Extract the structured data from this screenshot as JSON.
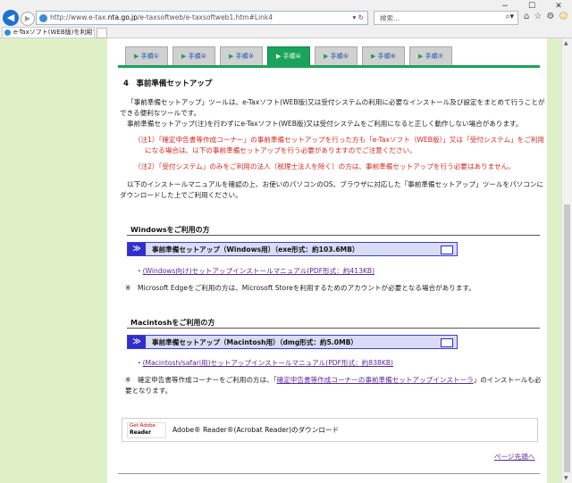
{
  "browser": {
    "url_prefix": "http://www.e-tax.",
    "url_domain": "nta.go.jp",
    "url_path": "/e-taxsoftweb/e-taxsoftweb1.htm#Link4",
    "search_placeholder": "検索...",
    "tab_title": "e-Taxソフト(WEB版)を利用す...",
    "window_controls": [
      "−",
      "☐",
      "✕"
    ]
  },
  "steps": [
    {
      "label": "手順①",
      "active": false
    },
    {
      "label": "手順②",
      "active": false
    },
    {
      "label": "手順③",
      "active": false
    },
    {
      "label": "手順④",
      "active": true
    },
    {
      "label": "手順⑤",
      "active": false
    },
    {
      "label": "手順⑥",
      "active": false
    },
    {
      "label": "手順⑦",
      "active": false
    }
  ],
  "section": {
    "title": "4　事前準備セットアップ",
    "intro_1": "「事前準備セットアップ」ツールは、e-Taxソフト(WEB版)又は受付システムの利用に必要なインストール及び設定をまとめて行うことができる便利なツールです。",
    "intro_2": "事前準備セットアップ(注)を行わずにe-Taxソフト(WEB版)又は受付システムをご利用になると正しく動作しない場合があります。",
    "note_1": "（注1）「確定申告書等作成コーナー」の事前準備セットアップを行った方も「e-Taxソフト（WEB版）」又は「受付システム」をご利用になる場合は、以下の事前準備セットアップを行う必要がありますのでご注意ください。",
    "note_2": "（注2）「受付システム」のみをご利用の法人（税理士法人を除く）の方は、事前準備セットアップを行う必要はありません。",
    "instruction": "以下のインストールマニュアルを確認の上、お使いのパソコンのOS、ブラウザに対応した「事前準備セットアップ」ツールをパソコンにダウンロードした上でご利用ください。"
  },
  "windows": {
    "heading": "Windowsをご利用の方",
    "download_label": "事前準備セットアップ（Windows用）（exe形式：約103.6MB）",
    "manual_link": "(Windows向け)セットアップインストールマニュアル(PDF形式：約413KB)",
    "note": "※　Microsoft Edgeをご利用の方は、Microsoft Storeを利用するためのアカウントが必要となる場合があります。"
  },
  "mac": {
    "heading": "Macintoshをご利用の方",
    "download_label": "事前準備セットアップ（Macintosh用）（dmg形式：約5.0MB）",
    "manual_link": "(Macintosh/safari用)セットアップインストールマニュアル(PDF形式：約838KB)",
    "note_prefix": "※　確定申告書等作成コーナーをご利用の方は、「",
    "note_link": "確定申告書等作成コーナーの事前準備セットアップインストーラ",
    "note_suffix": "」のインストールも必要となります。"
  },
  "adobe": {
    "logo_line1": "Get Adobe",
    "logo_line2": "Reader",
    "text": "Adobe® Reader®(Acrobat Reader)のダウンロード"
  },
  "page_top_link": "ページ先頭へ"
}
